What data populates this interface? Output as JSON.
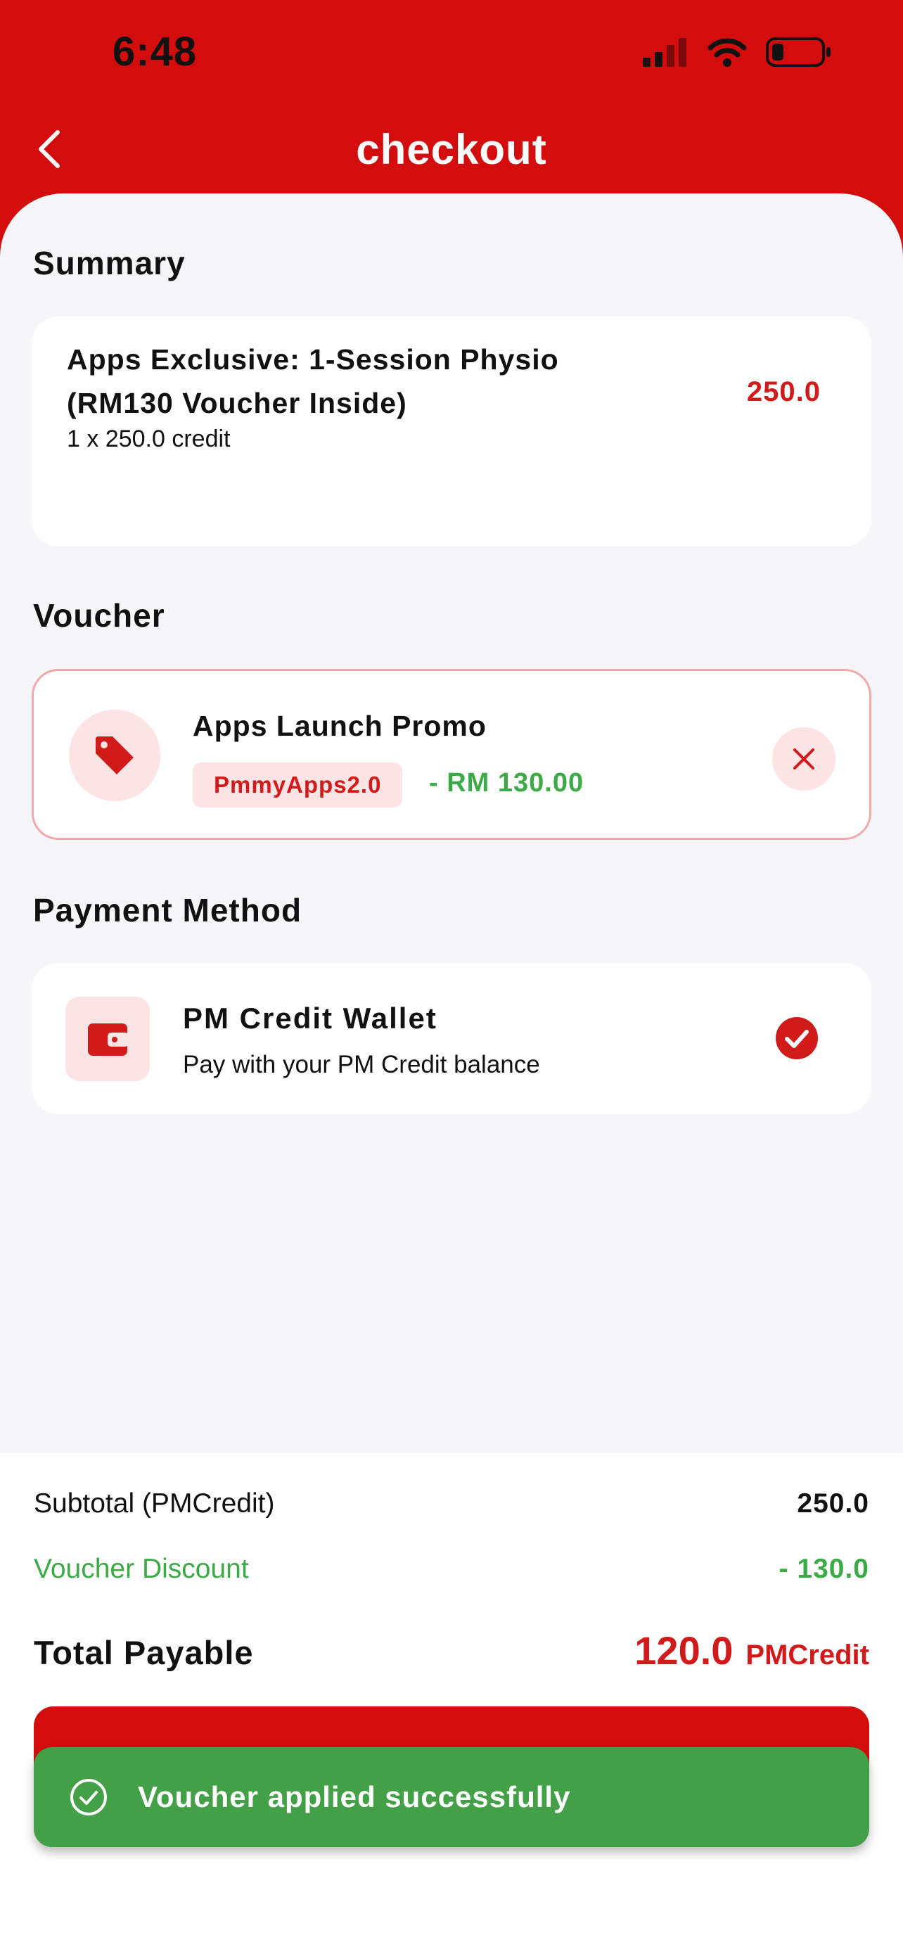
{
  "status_bar": {
    "time": "6:48"
  },
  "header": {
    "title": "checkout"
  },
  "summary": {
    "section_title": "Summary",
    "item_name": "Apps Exclusive: 1-Session Physio (RM130 Voucher Inside)",
    "item_quantity": "1 x 250.0 credit",
    "item_price": "250.0"
  },
  "voucher": {
    "section_title": "Voucher",
    "name": "Apps Launch Promo",
    "code": "PmmyApps2.0",
    "discount": "- RM 130.00"
  },
  "payment": {
    "section_title": "Payment Method",
    "method_name": "PM Credit Wallet",
    "method_description": "Pay with your PM Credit balance"
  },
  "totals": {
    "subtotal_label": "Subtotal (PMCredit)",
    "subtotal_value": "250.0",
    "discount_label": "Voucher Discount",
    "discount_value": "- 130.0",
    "total_label": "Total Payable",
    "total_value": "120.0",
    "total_unit": "PMCredit"
  },
  "toast": {
    "message": "Voucher applied successfully"
  },
  "colors": {
    "brand": "#d30d0e",
    "success": "#43a047",
    "discount_text": "#3daa48",
    "tint": "#fde4e4"
  }
}
